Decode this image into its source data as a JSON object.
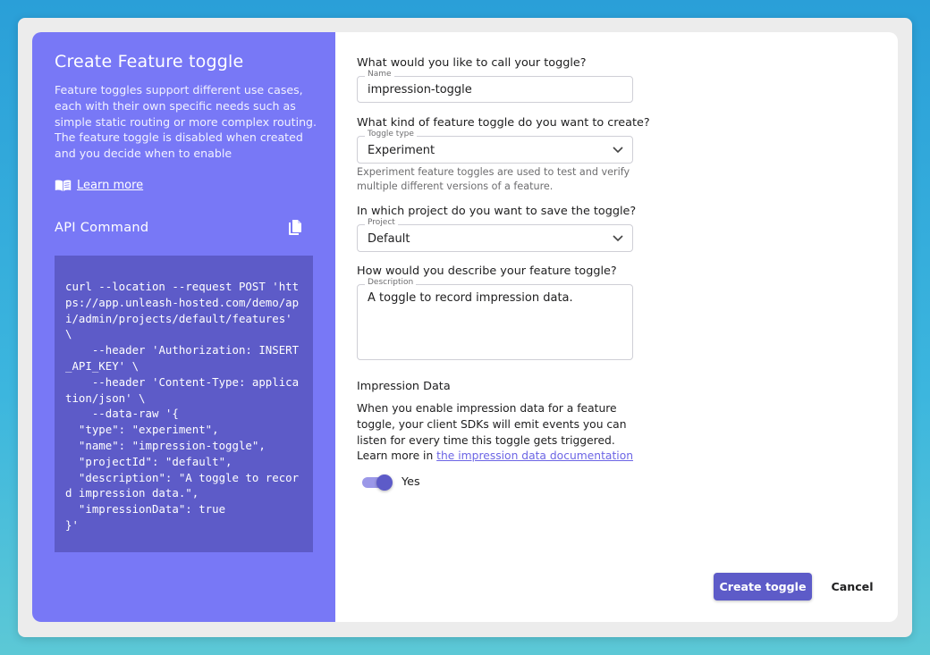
{
  "sidebar": {
    "title": "Create Feature toggle",
    "description": "Feature toggles support different use cases, each with their own specific needs such as simple static routing or more complex routing. The feature toggle is disabled when created and you decide when to enable",
    "learn_more": "Learn more",
    "api_title": "API Command",
    "api_command": "curl --location --request POST 'https://app.unleash-hosted.com/demo/api/admin/projects/default/features' \\\n    --header 'Authorization: INSERT_API_KEY' \\\n    --header 'Content-Type: application/json' \\\n    --data-raw '{\n  \"type\": \"experiment\",\n  \"name\": \"impression-toggle\",\n  \"projectId\": \"default\",\n  \"description\": \"A toggle to record impression data.\",\n  \"impressionData\": true\n}'"
  },
  "form": {
    "name_question": "What would you like to call your toggle?",
    "name_label": "Name",
    "name_value": "impression-toggle",
    "type_question": "What kind of feature toggle do you want to create?",
    "type_label": "Toggle type",
    "type_value": "Experiment",
    "type_help": "Experiment feature toggles are used to test and verify multiple different versions of a feature.",
    "project_question": "In which project do you want to save the toggle?",
    "project_label": "Project",
    "project_value": "Default",
    "desc_question": "How would you describe your feature toggle?",
    "desc_label": "Description",
    "desc_value": "A toggle to record impression data.",
    "impression_title": "Impression Data",
    "impression_text": "When you enable impression data for a feature toggle, your client SDKs will emit events you can listen for every time this toggle gets triggered. Learn more in",
    "impression_link": "the impression data documentation",
    "impression_toggle_label": "Yes",
    "impression_enabled": true
  },
  "actions": {
    "create": "Create toggle",
    "cancel": "Cancel"
  },
  "colors": {
    "sidebar_bg": "#7878f6",
    "code_bg": "#5d5bc8",
    "primary": "#5d5bc8",
    "link": "#6c65e5"
  },
  "icons": {
    "learn_more": "book-icon",
    "copy": "copy-icon",
    "select": "chevron-down-icon"
  }
}
